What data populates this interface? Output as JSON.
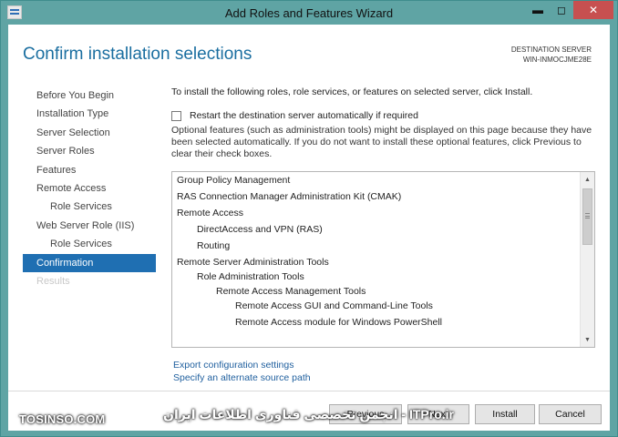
{
  "window": {
    "title": "Add Roles and Features Wizard",
    "controls": {
      "minimize": "▬",
      "maximize": "◻",
      "close": "✕"
    }
  },
  "header": {
    "title": "Confirm installation selections",
    "destination_label": "DESTINATION SERVER",
    "destination_value": "WIN-INMOCJME28E"
  },
  "nav": {
    "items": [
      {
        "label": "Before You Begin"
      },
      {
        "label": "Installation Type"
      },
      {
        "label": "Server Selection"
      },
      {
        "label": "Server Roles"
      },
      {
        "label": "Features"
      },
      {
        "label": "Remote Access"
      },
      {
        "label": "Role Services"
      },
      {
        "label": "Web Server Role (IIS)"
      },
      {
        "label": "Role Services"
      },
      {
        "label": "Confirmation"
      },
      {
        "label": "Results"
      }
    ]
  },
  "content": {
    "intro": "To install the following roles, role services, or features on selected server, click Install.",
    "restart_checkbox": {
      "label": "Restart the destination server automatically if required",
      "checked": false
    },
    "optional_text": "Optional features (such as administration tools) might be displayed on this page because they have been selected automatically. If you do not want to install these optional features, click Previous to clear their check boxes.",
    "features": [
      {
        "label": "Group Policy Management"
      },
      {
        "label": "RAS Connection Manager Administration Kit (CMAK)"
      },
      {
        "label": "Remote Access"
      },
      {
        "label": "DirectAccess and VPN (RAS)"
      },
      {
        "label": "Routing"
      },
      {
        "label": "Remote Server Administration Tools"
      },
      {
        "label": "Role Administration Tools"
      },
      {
        "label": "Remote Access Management Tools"
      },
      {
        "label": "Remote Access GUI and Command-Line Tools"
      },
      {
        "label": "Remote Access module for Windows PowerShell"
      }
    ],
    "links": {
      "export": "Export configuration settings",
      "alternate_source": "Specify an alternate source path"
    }
  },
  "footer": {
    "previous": "Previous",
    "next": "Next",
    "install": "Install",
    "cancel": "Cancel"
  },
  "watermark": {
    "left": "TOSINSO.COM",
    "right": "انجمن تخصصی فناوری اطلاعات ایران - ITPro.ir"
  },
  "colors": {
    "accent": "#1f6fb2",
    "title_blue": "#1a6ea0",
    "link": "#1f5f9e",
    "frame": "#5fa4a4",
    "close": "#c75050"
  }
}
